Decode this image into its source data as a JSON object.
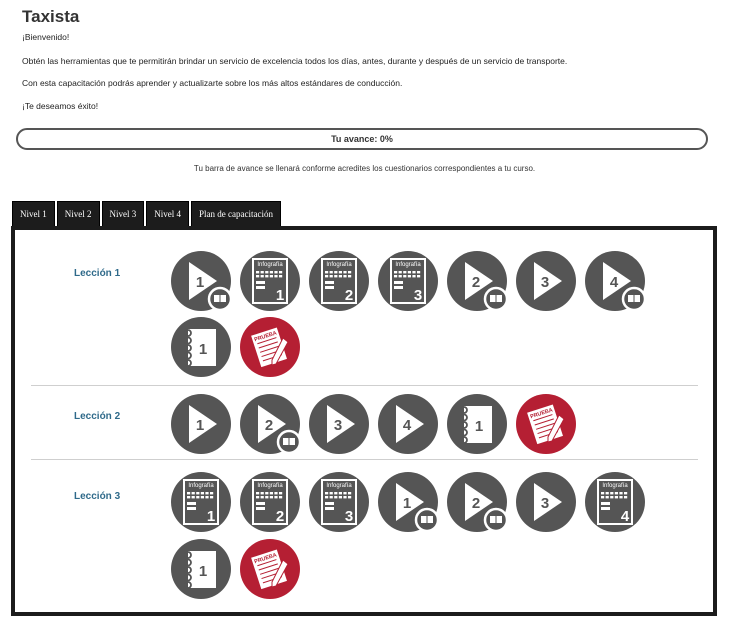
{
  "page": {
    "title": "Taxista",
    "welcome": "¡Bienvenido!",
    "intro1": "Obtén las herramientas que te permitirán brindar un servicio de excelencia todos los días, antes, durante y después de un servicio de transporte.",
    "intro2": "Con esta capacitación podrás aprender y actualizarte sobre los más altos estándares de conducción.",
    "wish": "¡Te deseamos éxito!"
  },
  "progress": {
    "label": "Tu avance: 0%",
    "value": 0,
    "note": "Tu barra de avance se llenará conforme acredites los cuestionarios correspondientes a tu curso."
  },
  "tabs": [
    "Nivel 1",
    "Nivel 2",
    "Nivel 3",
    "Nivel 4",
    "Plan de capacitación"
  ],
  "colors": {
    "icon_gray": "#555555",
    "icon_red": "#b51f33",
    "lesson_label": "#2f6a8a",
    "tab_bg": "#1c1c1c"
  },
  "lessons": [
    {
      "label": "Lección 1",
      "items": [
        {
          "icon": "video-book-icon",
          "number": "1"
        },
        {
          "icon": "infographic-icon",
          "number": "1",
          "caption": "Infografía"
        },
        {
          "icon": "infographic-icon",
          "number": "2",
          "caption": "Infografía"
        },
        {
          "icon": "infographic-icon",
          "number": "3",
          "caption": "Infografía"
        },
        {
          "icon": "video-book-icon",
          "number": "2"
        },
        {
          "icon": "video-icon",
          "number": "3"
        },
        {
          "icon": "video-book-icon",
          "number": "4"
        },
        {
          "icon": "notebook-icon",
          "number": "1"
        },
        {
          "icon": "quiz-icon",
          "caption": "PRUEBA"
        }
      ]
    },
    {
      "label": "Lección 2",
      "items": [
        {
          "icon": "video-icon",
          "number": "1"
        },
        {
          "icon": "video-book-icon",
          "number": "2"
        },
        {
          "icon": "video-icon",
          "number": "3"
        },
        {
          "icon": "video-icon",
          "number": "4"
        },
        {
          "icon": "notebook-icon",
          "number": "1"
        },
        {
          "icon": "quiz-icon",
          "caption": "PRUEBA"
        }
      ]
    },
    {
      "label": "Lección 3",
      "items": [
        {
          "icon": "infographic-icon",
          "number": "1",
          "caption": "Infografía"
        },
        {
          "icon": "infographic-icon",
          "number": "2",
          "caption": "Infografía"
        },
        {
          "icon": "infographic-icon",
          "number": "3",
          "caption": "Infografía"
        },
        {
          "icon": "video-book-icon",
          "number": "1"
        },
        {
          "icon": "video-book-icon",
          "number": "2"
        },
        {
          "icon": "video-icon",
          "number": "3"
        },
        {
          "icon": "infographic-icon",
          "number": "4",
          "caption": "Infografía"
        },
        {
          "icon": "notebook-icon",
          "number": "1"
        },
        {
          "icon": "quiz-icon",
          "caption": "PRUEBA"
        }
      ]
    }
  ]
}
